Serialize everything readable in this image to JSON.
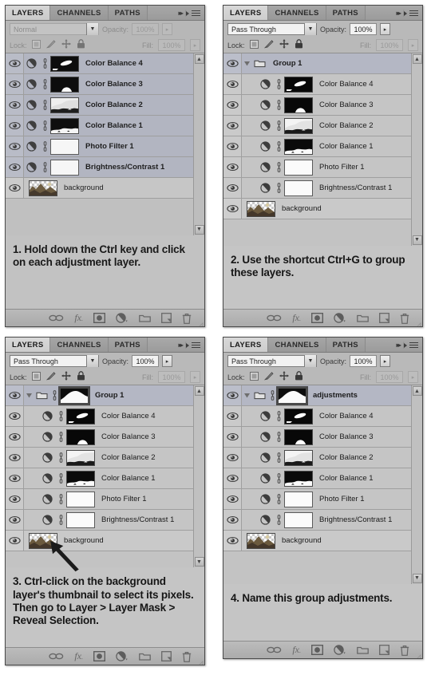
{
  "meta": {
    "app": "Adobe Photoshop Layers Panel",
    "tutorial": "Grouping adjustment layers and adding a group layer mask"
  },
  "colors": {
    "panel_bg": "#b9b9b9",
    "row_bg": "#c5c5c5",
    "row_selected": "#b4b7c4",
    "tab_active": "#d8d8d8",
    "border": "#494949",
    "text": "#1b1b1b"
  },
  "tabs": [
    {
      "label": "LAYERS",
      "active": true
    },
    {
      "label": "CHANNELS",
      "active": false
    },
    {
      "label": "PATHS",
      "active": false
    }
  ],
  "controls": {
    "opacity_label": "Opacity:",
    "opacity_value": "100%",
    "fill_label": "Fill:",
    "fill_value": "100%",
    "lock_label": "Lock:",
    "lock_icons": [
      "lock-transparent-pixels-icon",
      "lock-image-pixels-icon",
      "lock-position-icon",
      "lock-all-icon"
    ]
  },
  "toolbar_icons": [
    "link-layers-icon",
    "layer-style-fx-icon",
    "add-layer-mask-icon",
    "new-adjustment-layer-icon",
    "new-group-icon",
    "new-layer-icon",
    "delete-layer-icon"
  ],
  "panels": [
    {
      "id": "panel-1",
      "step": "1",
      "blend_mode": "Normal",
      "blend_mode_dim": true,
      "caption": "1. Hold down the Ctrl key and click on each adjustment layer.",
      "has_group": false,
      "rows": [
        {
          "name": "Color Balance 4",
          "type": "adjustment",
          "selected": true,
          "thumb": "mask-dark-streak",
          "indent": 0,
          "bold": true
        },
        {
          "name": "Color Balance 3",
          "type": "adjustment",
          "selected": true,
          "thumb": "mask-dark-bump",
          "indent": 0,
          "bold": true
        },
        {
          "name": "Color Balance 2",
          "type": "adjustment",
          "selected": true,
          "thumb": "mask-light-hills",
          "indent": 0,
          "bold": true
        },
        {
          "name": "Color Balance 1",
          "type": "adjustment",
          "selected": true,
          "thumb": "mask-dark-hills",
          "indent": 0,
          "bold": true
        },
        {
          "name": "Photo Filter 1",
          "type": "adjustment",
          "selected": true,
          "thumb": "mask-white",
          "indent": 0,
          "bold": true
        },
        {
          "name": "Brightness/Contrast 1",
          "type": "adjustment",
          "selected": true,
          "thumb": "mask-white",
          "indent": 0,
          "bold": true
        },
        {
          "name": "background",
          "type": "image",
          "selected": false,
          "thumb": "photo-thumb",
          "indent": 0,
          "bold": false
        }
      ]
    },
    {
      "id": "panel-2",
      "step": "2",
      "blend_mode": "Pass Through",
      "blend_mode_dim": false,
      "caption": "2. Use the shortcut Ctrl+G to group these layers.",
      "has_group": true,
      "group": {
        "name": "Group 1",
        "selected": true,
        "has_mask": false
      },
      "rows": [
        {
          "name": "Color Balance 4",
          "type": "adjustment",
          "selected": false,
          "thumb": "mask-dark-streak",
          "indent": 1,
          "bold": false
        },
        {
          "name": "Color Balance 3",
          "type": "adjustment",
          "selected": false,
          "thumb": "mask-dark-bump",
          "indent": 1,
          "bold": false
        },
        {
          "name": "Color Balance 2",
          "type": "adjustment",
          "selected": false,
          "thumb": "mask-light-hills",
          "indent": 1,
          "bold": false
        },
        {
          "name": "Color Balance 1",
          "type": "adjustment",
          "selected": false,
          "thumb": "mask-dark-hills",
          "indent": 1,
          "bold": false
        },
        {
          "name": "Photo Filter 1",
          "type": "adjustment",
          "selected": false,
          "thumb": "mask-white",
          "indent": 1,
          "bold": false
        },
        {
          "name": "Brightness/Contrast 1",
          "type": "adjustment",
          "selected": false,
          "thumb": "mask-white",
          "indent": 1,
          "bold": false
        },
        {
          "name": "background",
          "type": "image",
          "selected": false,
          "thumb": "photo-thumb",
          "indent": 0,
          "bold": false
        }
      ]
    },
    {
      "id": "panel-3",
      "step": "3",
      "blend_mode": "Pass Through",
      "blend_mode_dim": false,
      "caption": "3. Ctrl-click on the background layer's thumbnail to select its pixels. Then go to Layer > Layer Mask > Reveal Selection.",
      "has_group": true,
      "has_arrow": true,
      "group": {
        "name": "Group 1",
        "selected": true,
        "has_mask": true,
        "mask_thumb": "mask-histogram"
      },
      "rows": [
        {
          "name": "Color Balance 4",
          "type": "adjustment",
          "selected": false,
          "thumb": "mask-dark-streak",
          "indent": 1,
          "bold": false
        },
        {
          "name": "Color Balance 3",
          "type": "adjustment",
          "selected": false,
          "thumb": "mask-dark-bump",
          "indent": 1,
          "bold": false
        },
        {
          "name": "Color Balance 2",
          "type": "adjustment",
          "selected": false,
          "thumb": "mask-light-hills",
          "indent": 1,
          "bold": false
        },
        {
          "name": "Color Balance 1",
          "type": "adjustment",
          "selected": false,
          "thumb": "mask-dark-hills",
          "indent": 1,
          "bold": false
        },
        {
          "name": "Photo Filter 1",
          "type": "adjustment",
          "selected": false,
          "thumb": "mask-white",
          "indent": 1,
          "bold": false
        },
        {
          "name": "Brightness/Contrast 1",
          "type": "adjustment",
          "selected": false,
          "thumb": "mask-white",
          "indent": 1,
          "bold": false
        },
        {
          "name": "background",
          "type": "image",
          "selected": false,
          "thumb": "photo-thumb",
          "indent": 0,
          "bold": false
        }
      ]
    },
    {
      "id": "panel-4",
      "step": "4",
      "blend_mode": "Pass Through",
      "blend_mode_dim": false,
      "caption": "4. Name this group adjustments.",
      "has_group": true,
      "group": {
        "name": "adjustments",
        "selected": true,
        "has_mask": true,
        "mask_thumb": "mask-histogram"
      },
      "rows": [
        {
          "name": "Color Balance 4",
          "type": "adjustment",
          "selected": false,
          "thumb": "mask-dark-streak",
          "indent": 1,
          "bold": false
        },
        {
          "name": "Color Balance 3",
          "type": "adjustment",
          "selected": false,
          "thumb": "mask-dark-bump",
          "indent": 1,
          "bold": false
        },
        {
          "name": "Color Balance 2",
          "type": "adjustment",
          "selected": false,
          "thumb": "mask-light-hills",
          "indent": 1,
          "bold": false
        },
        {
          "name": "Color Balance 1",
          "type": "adjustment",
          "selected": false,
          "thumb": "mask-dark-hills",
          "indent": 1,
          "bold": false
        },
        {
          "name": "Photo Filter 1",
          "type": "adjustment",
          "selected": false,
          "thumb": "mask-white",
          "indent": 1,
          "bold": false
        },
        {
          "name": "Brightness/Contrast 1",
          "type": "adjustment",
          "selected": false,
          "thumb": "mask-white",
          "indent": 1,
          "bold": false
        },
        {
          "name": "background",
          "type": "image",
          "selected": false,
          "thumb": "photo-thumb",
          "indent": 0,
          "bold": false
        }
      ]
    }
  ]
}
